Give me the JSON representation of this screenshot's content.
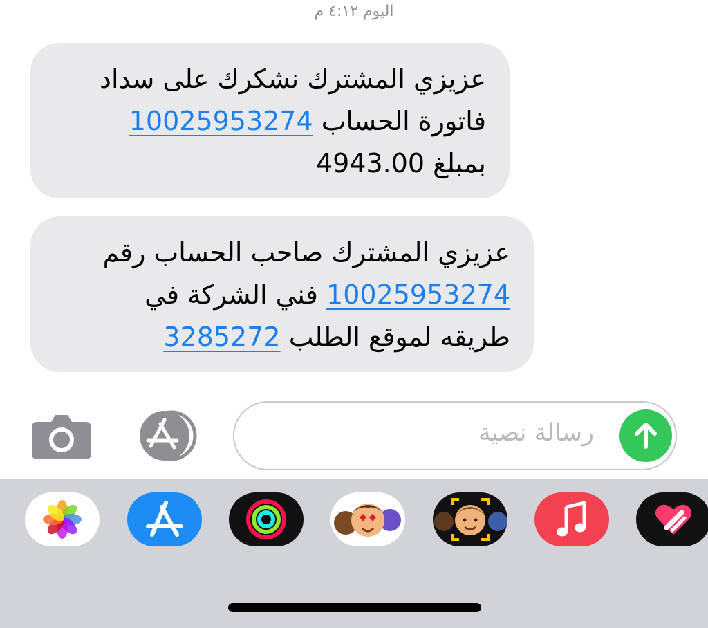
{
  "header": {
    "timestamp": "اليوم ٤:١٢ م"
  },
  "messages": [
    {
      "line1": "عزيزي المشترك نشكرك على سداد",
      "line2_text": "فاتورة الحساب",
      "line2_link": "10025953274",
      "line3": "بمبلغ 4943.00"
    },
    {
      "line1": "عزيزي المشترك صاحب الحساب رقم",
      "line2_link": "10025953274",
      "line2_text": "فني الشركة في",
      "line3_text": "طريقه لموقع الطلب",
      "line3_link": "3285272"
    }
  ],
  "composer": {
    "placeholder": "رسالة نصية",
    "camera_icon": "camera-icon",
    "appstore_icon": "appstore-icon",
    "send_icon": "arrow-up-icon"
  },
  "app_drawer": [
    {
      "name": "photos-icon"
    },
    {
      "name": "appstore-icon"
    },
    {
      "name": "activity-icon"
    },
    {
      "name": "memoji-stickers-icon"
    },
    {
      "name": "memoji-icon"
    },
    {
      "name": "music-icon"
    },
    {
      "name": "digital-touch-icon"
    }
  ],
  "colors": {
    "bubble_bg": "#e9e9eb",
    "link": "#1a7ff0",
    "send": "#34c759",
    "drawer_bg": "#d1d3d9"
  }
}
